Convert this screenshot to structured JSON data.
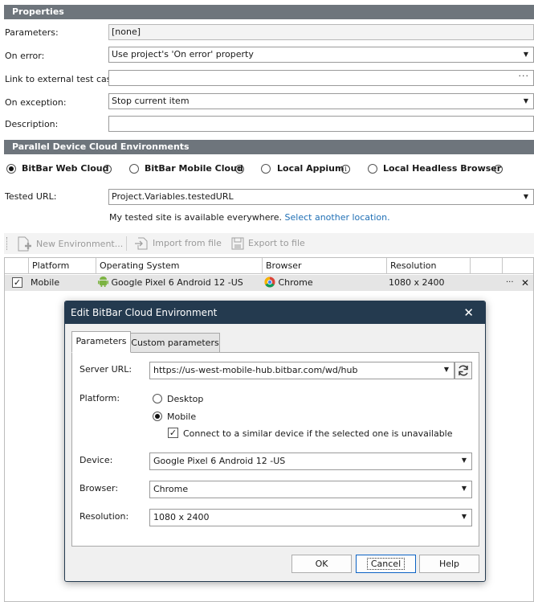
{
  "properties": {
    "header": "Properties",
    "parameters_label": "Parameters:",
    "parameters_value": "[none]",
    "on_error_label": "On error:",
    "on_error_value": "Use project's 'On error' property",
    "link_label": "Link to external test case:",
    "link_value": "",
    "on_exception_label": "On exception:",
    "on_exception_value": "Stop current item",
    "description_label": "Description:",
    "description_value": ""
  },
  "environments": {
    "header": "Parallel Device Cloud Environments",
    "radios": [
      {
        "label": "BitBar Web Cloud",
        "selected": true
      },
      {
        "label": "BitBar Mobile Cloud",
        "selected": false
      },
      {
        "label": "Local Appium",
        "selected": false
      },
      {
        "label": "Local Headless Browser",
        "selected": false
      }
    ],
    "info_glyph": "i",
    "tested_url_label": "Tested URL:",
    "tested_url_value": "Project.Variables.testedURL",
    "location_note": "My tested site is available everywhere.",
    "location_link": "Select another location."
  },
  "toolbar": {
    "new_env": "New Environment...",
    "import": "Import from file",
    "export": "Export to file"
  },
  "grid": {
    "columns": [
      "Platform",
      "Operating System",
      "Browser",
      "Resolution"
    ],
    "rows": [
      {
        "checked": true,
        "platform": "Mobile",
        "os": "Google Pixel 6 Android 12 -US",
        "browser": "Chrome",
        "resolution": "1080 x 2400",
        "more": "···",
        "remove": "✕"
      }
    ]
  },
  "dialog": {
    "title": "Edit BitBar Cloud Environment",
    "close": "✕",
    "tabs": [
      "Parameters",
      "Custom parameters"
    ],
    "server_url_label": "Server URL:",
    "server_url_value": "https://us-west-mobile-hub.bitbar.com/wd/hub",
    "platform_label": "Platform:",
    "platform_options": [
      {
        "label": "Desktop",
        "selected": false
      },
      {
        "label": "Mobile",
        "selected": true
      }
    ],
    "similar_device_label": "Connect to a similar device if the selected one is unavailable",
    "similar_device_checked": true,
    "device_label": "Device:",
    "device_value": "Google Pixel 6 Android 12 -US",
    "browser_label": "Browser:",
    "browser_value": "Chrome",
    "resolution_label": "Resolution:",
    "resolution_value": "1080 x 2400",
    "ok": "OK",
    "cancel": "Cancel",
    "help": "Help"
  },
  "glyphs": {
    "dropdown": "▼",
    "ellipsis": "···",
    "check": "✓"
  },
  "colors": {
    "section_header": "#6e757c",
    "dialog_title": "#243a4f",
    "link": "#1f6fb5",
    "android": "#7cb342"
  }
}
